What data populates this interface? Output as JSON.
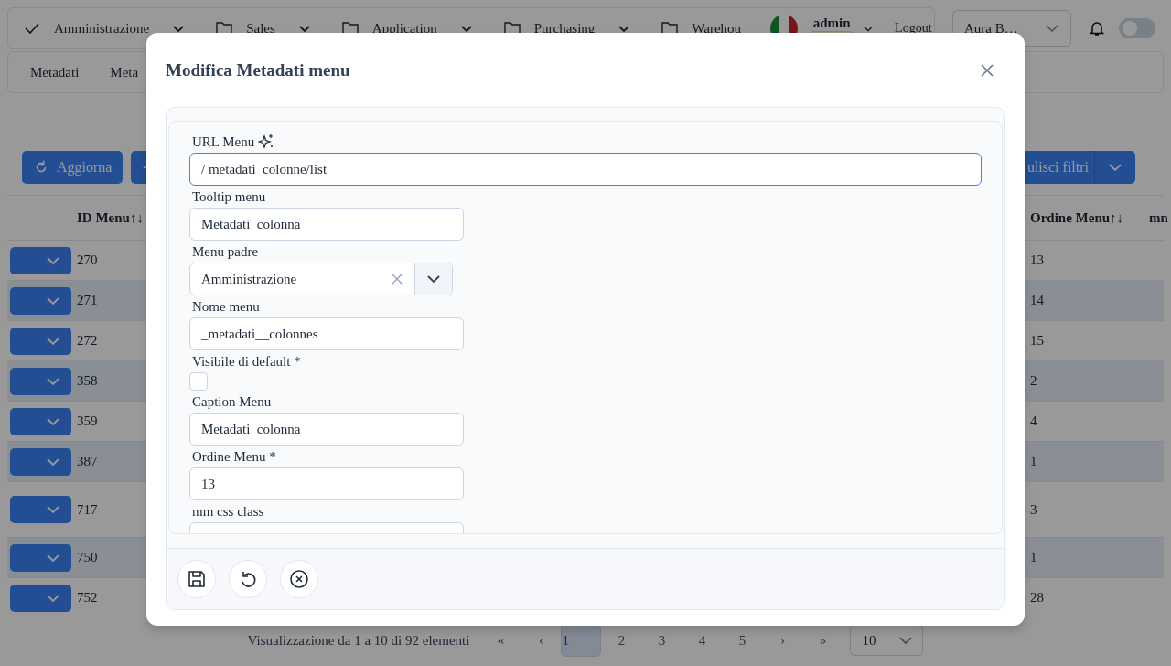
{
  "nav": {
    "items": [
      {
        "label": "Amministrazione",
        "kind": "check"
      },
      {
        "label": "Sales",
        "kind": "folder"
      },
      {
        "label": "Application",
        "kind": "folder"
      },
      {
        "label": "Purchasing",
        "kind": "folder"
      },
      {
        "label": "Warehou",
        "kind": "folder"
      }
    ],
    "user": "admin",
    "logout": "Logout",
    "company": "Aura B…",
    "dark_mode": false
  },
  "subnav": {
    "tabs": [
      "Metadati",
      "Meta"
    ]
  },
  "toolbar": {
    "refresh": "Aggiorna",
    "clear_filters": "ulisci filtri"
  },
  "table": {
    "columns": [
      "ID Menu↑↓",
      "Ordine Menu↑↓",
      "mn"
    ],
    "rows": [
      {
        "id": "270",
        "ordine": "13",
        "tall": false
      },
      {
        "id": "271",
        "ordine": "14",
        "tall": false
      },
      {
        "id": "272",
        "ordine": "15",
        "tall": false
      },
      {
        "id": "358",
        "ordine": "2",
        "tall": false
      },
      {
        "id": "359",
        "ordine": "4",
        "tall": false
      },
      {
        "id": "387",
        "ordine": "1",
        "tall": false
      },
      {
        "id": "717",
        "ordine": "3",
        "tall": true
      },
      {
        "id": "750",
        "ordine": "1",
        "tall": false
      },
      {
        "id": "752",
        "ordine": "28",
        "tall": false
      }
    ]
  },
  "pagination": {
    "summary": "Visualizzazione da 1 a 10 di 92 elementi",
    "first": "«",
    "prev": "‹",
    "next": "›",
    "last": "»",
    "pages": [
      {
        "label": "1",
        "selected": true
      },
      {
        "label": "2",
        "selected": false
      },
      {
        "label": "3",
        "selected": false
      },
      {
        "label": "4",
        "selected": false
      },
      {
        "label": "5",
        "selected": false
      }
    ],
    "page_size": "10"
  },
  "modal": {
    "title": "Modifica Metadati menu",
    "fields": [
      {
        "kind": "url",
        "label": "URL Menu",
        "value": "/ metadati  colonne/list",
        "focused": true
      },
      {
        "kind": "text",
        "label": "Tooltip menu",
        "value": "Metadati  colonna",
        "focused": false
      },
      {
        "kind": "select",
        "label": "Menu padre",
        "value": "Amministrazione",
        "focused": false
      },
      {
        "kind": "text",
        "label": "Nome menu",
        "value": "_metadati__colonnes",
        "focused": false
      },
      {
        "kind": "checkbox",
        "label": "Visibile di default *",
        "checked": false
      },
      {
        "kind": "text",
        "label": "Caption Menu",
        "value": "Metadati  colonna",
        "focused": false
      },
      {
        "kind": "text",
        "label": "Ordine Menu *",
        "value": "13",
        "focused": false
      },
      {
        "kind": "text",
        "label": "mm css class",
        "focused": false
      }
    ]
  }
}
